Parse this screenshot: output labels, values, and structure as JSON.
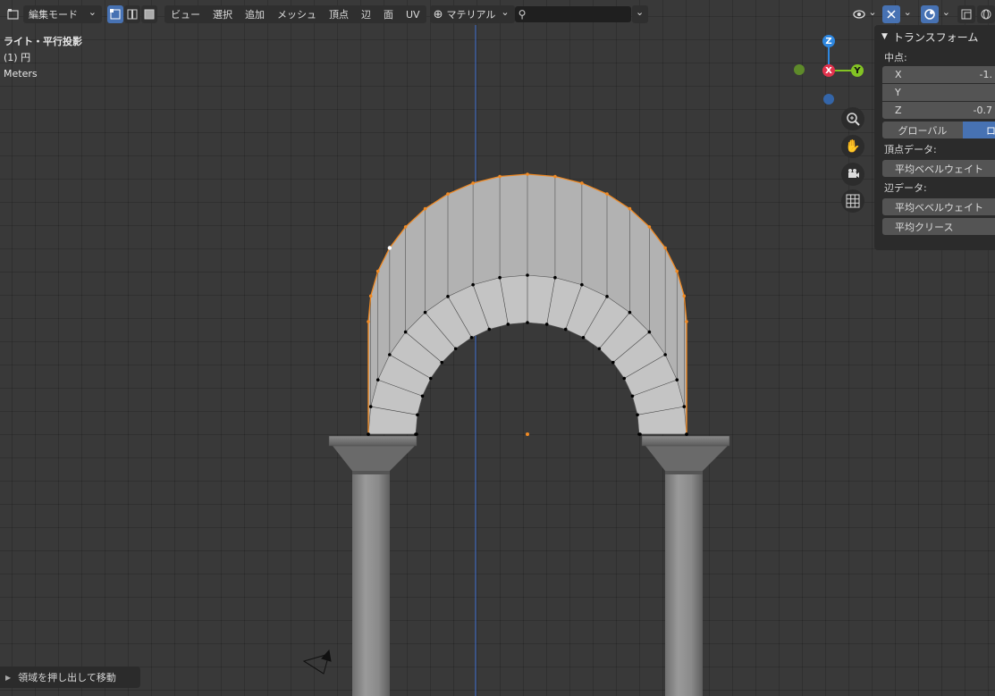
{
  "header": {
    "mode": "編集モード",
    "menus": [
      "ビュー",
      "選択",
      "追加",
      "メッシュ",
      "頂点",
      "辺",
      "面",
      "UV"
    ],
    "material": "マテリアル",
    "search_value": ""
  },
  "overlay": {
    "view_name": "ライト・平行投影",
    "object_name": "(1) 円",
    "units": "Meters"
  },
  "gizmo": {
    "x_label": "X",
    "y_label": "Y",
    "z_label": "Z",
    "x_color": "#e2334d",
    "y_color": "#83c324",
    "z_color": "#2e87e0"
  },
  "sidebar": {
    "title": "トランスフォーム",
    "median_label": "中点:",
    "x_label": "X",
    "x_value": "-1.",
    "y_label": "Y",
    "y_value": "",
    "z_label": "Z",
    "z_value": "-0.7",
    "global_label": "グローバル",
    "local_label": "ロ",
    "vertex_data_label": "頂点データ:",
    "vertex_bevel_label": "平均ベベルウェイト",
    "edge_data_label": "辺データ:",
    "edge_bevel_label": "平均ベベルウェイト",
    "edge_crease_label": "平均クリース"
  },
  "last_operation": "領域を押し出して移動",
  "colors": {
    "accent": "#4772b3",
    "selection": "#f08a24",
    "z_axis_line": "#3f6fd1"
  }
}
